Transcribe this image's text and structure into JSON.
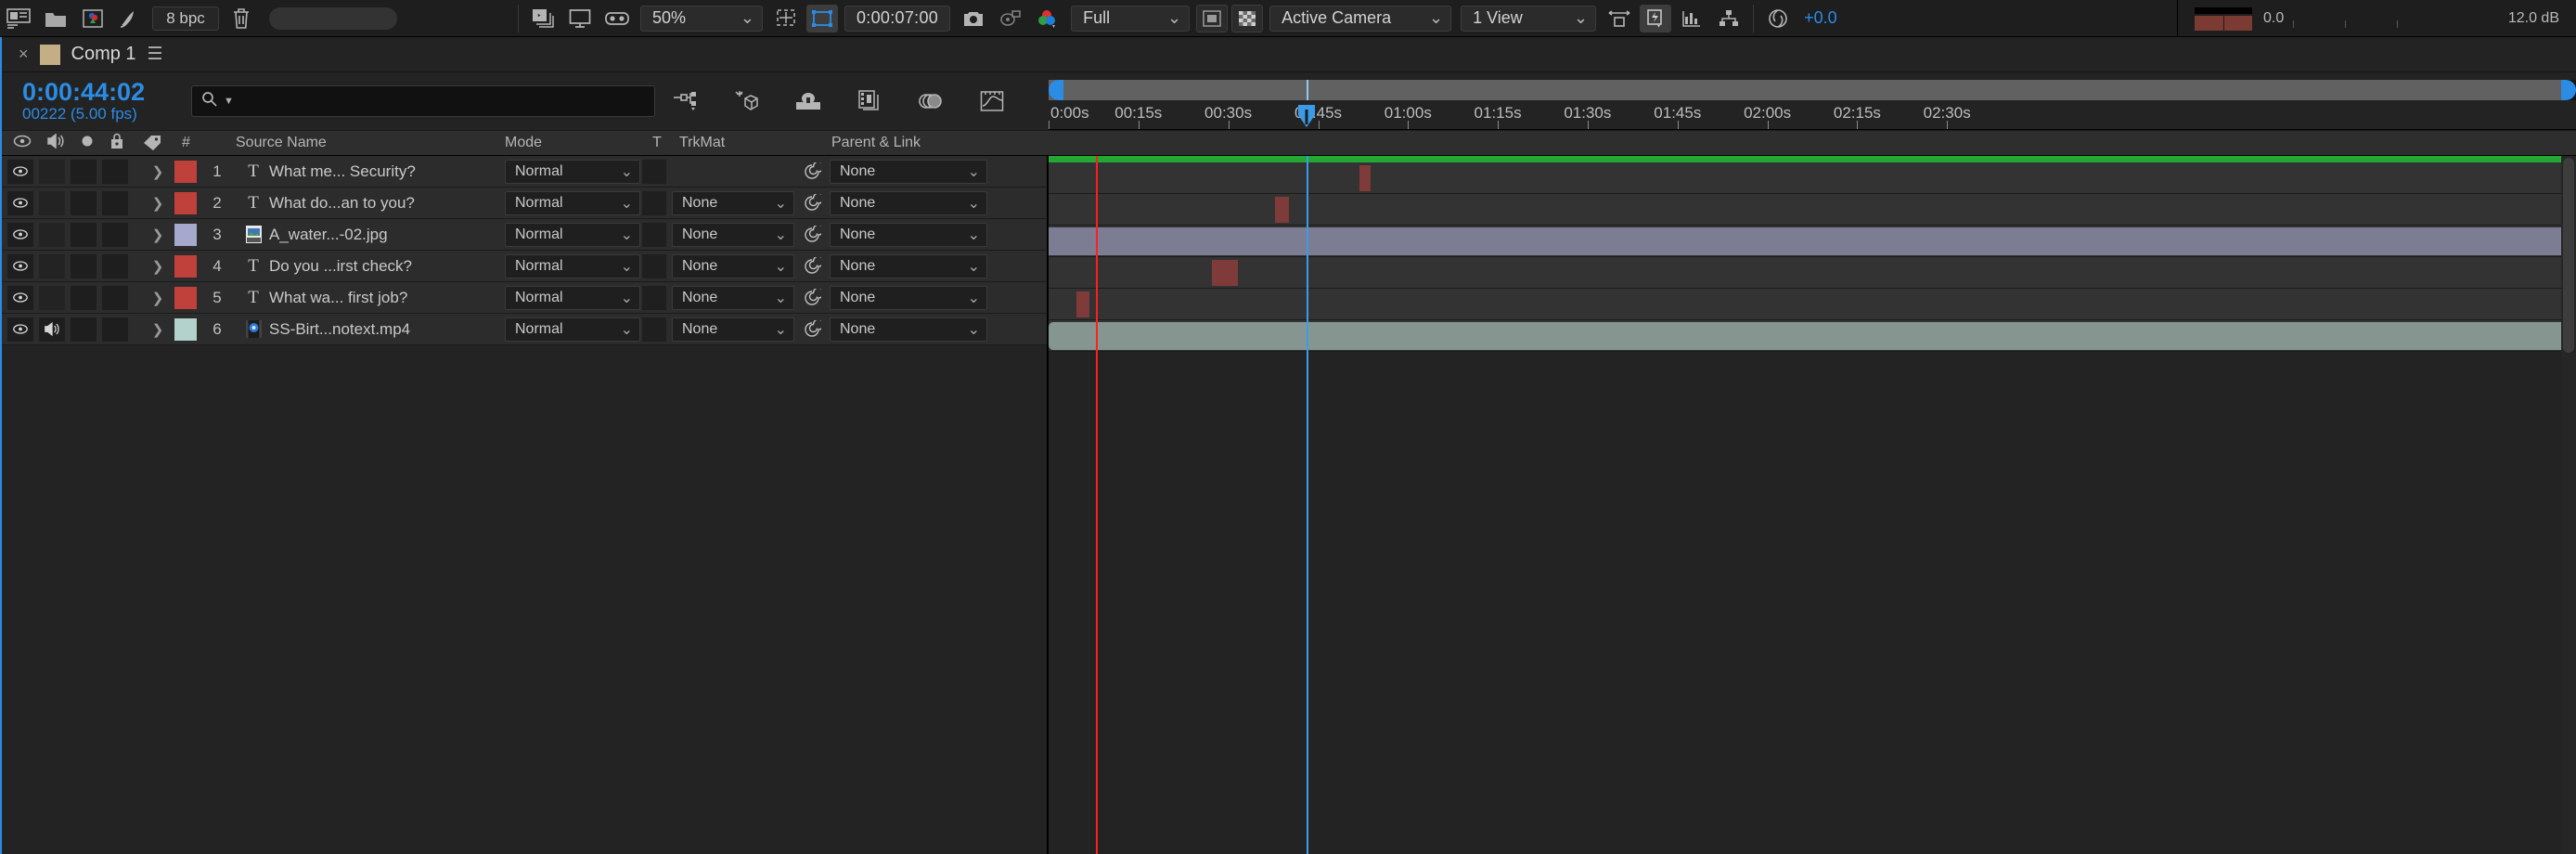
{
  "toolbar": {
    "left_icons": [
      "workspace-icon",
      "folder-icon",
      "project-media-icon",
      "rocket-icon"
    ],
    "bpc_label": "8 bpc",
    "trash_icon": "trash-icon",
    "search_pill": "search-pill",
    "render_icon": "render-queue-icon",
    "monitor_icon": "monitor-icon",
    "vr_icon": "vr-headset-icon",
    "zoom_value": "50%",
    "grid_icon": "grid-guides-icon",
    "region_icon": "region-of-interest-icon",
    "timecode": "0:00:07:00",
    "snapshot_icon": "camera-icon",
    "show_snapshot_icon": "show-snapshot-icon",
    "channels_icon": "channels-icon",
    "resolution": "Full",
    "mask_icon": "mask-icon",
    "transparency_icon": "transparency-grid-icon",
    "camera_view": "Active Camera",
    "view_layout": "1 View",
    "pixel_aspect_icon": "pixel-aspect-icon",
    "fast_preview_icon": "fast-preview-icon",
    "histogram_icon": "histogram-icon",
    "flowchart_icon": "flowchart-icon",
    "exposure_icon": "exposure-icon",
    "exposure_value": "+0.0",
    "audio_level_value": "0.0",
    "audio_db": "12.0 dB"
  },
  "tab": {
    "close_label": "×",
    "title": "Comp 1",
    "menu_icon": "panel-menu-icon"
  },
  "timeline_header": {
    "current_time": "0:00:44:02",
    "frame_info": "00222 (5.00 fps)",
    "search_placeholder": "",
    "search_value": "",
    "tools": [
      "composition-mini-flowchart-icon",
      "draft-3d-icon",
      "hide-shy-layers-icon",
      "frame-blending-icon",
      "motion-blur-icon",
      "graph-editor-icon"
    ]
  },
  "ruler": {
    "ticks": [
      {
        "label": "0:00s",
        "pos": 0.0
      },
      {
        "label": "00:15s",
        "pos": 0.0588
      },
      {
        "label": "00:30s",
        "pos": 0.1176
      },
      {
        "label": "00:45s",
        "pos": 0.1765
      },
      {
        "label": "01:00s",
        "pos": 0.2353
      },
      {
        "label": "01:15s",
        "pos": 0.2941
      },
      {
        "label": "01:30s",
        "pos": 0.3529
      },
      {
        "label": "01:45s",
        "pos": 0.4118
      },
      {
        "label": "02:00s",
        "pos": 0.4706
      },
      {
        "label": "02:15s",
        "pos": 0.5294
      },
      {
        "label": "02:30s",
        "pos": 0.5882
      }
    ]
  },
  "columns": {
    "num": "#",
    "source_name": "Source Name",
    "mode": "Mode",
    "t": "T",
    "trkmat": "TrkMat",
    "parent_link": "Parent & Link",
    "toggle_icons": [
      "eye-icon",
      "audio-icon",
      "solo-icon",
      "lock-icon",
      "label-tag-icon"
    ]
  },
  "layers": [
    {
      "num": "1",
      "type_icon": "text-layer-icon",
      "name": "What me... Security?",
      "color": "#c0403c",
      "mode": "Normal",
      "trkmat": null,
      "parent": "None",
      "video_on": true,
      "audio_on": false,
      "clip": null,
      "keyframes": [
        {
          "left": 0.2054,
          "width": 0.0075
        }
      ]
    },
    {
      "num": "2",
      "type_icon": "text-layer-icon",
      "name": "What do...an to you?",
      "color": "#c0403c",
      "mode": "Normal",
      "trkmat": "None",
      "parent": "None",
      "video_on": true,
      "audio_on": false,
      "clip": null,
      "keyframes": [
        {
          "left": 0.1494,
          "width": 0.0098
        }
      ]
    },
    {
      "num": "3",
      "type_icon": "jpeg-file-icon",
      "name": "A_water...-02.jpg",
      "color": "#a6a8cd",
      "mode": "Normal",
      "trkmat": "None",
      "parent": "None",
      "video_on": true,
      "audio_on": false,
      "clip": {
        "kind": "img",
        "left": 0.0,
        "width": 1.0
      },
      "keyframes": []
    },
    {
      "num": "4",
      "type_icon": "text-layer-icon",
      "name": "Do you ...irst check?",
      "color": "#c0403c",
      "mode": "Normal",
      "trkmat": "None",
      "parent": "None",
      "video_on": true,
      "audio_on": false,
      "clip": null,
      "keyframes": [
        {
          "left": 0.1077,
          "width": 0.0176
        }
      ]
    },
    {
      "num": "5",
      "type_icon": "text-layer-icon",
      "name": "What wa...  first job?",
      "color": "#c0403c",
      "mode": "Normal",
      "trkmat": "None",
      "parent": "None",
      "video_on": true,
      "audio_on": false,
      "clip": null,
      "keyframes": [
        {
          "left": 0.0185,
          "width": 0.0087
        }
      ]
    },
    {
      "num": "6",
      "type_icon": "mp4-file-icon",
      "name": "SS-Birt...notext.mp4",
      "color": "#b3d2cb",
      "mode": "Normal",
      "trkmat": "None",
      "parent": "None",
      "video_on": true,
      "audio_on": true,
      "clip": {
        "kind": "vid",
        "left": 0.0,
        "width": 1.0
      },
      "keyframes": []
    }
  ],
  "playheads": {
    "red_marker_pos": 0.0313,
    "cti_pos": 0.1704
  },
  "colors": {
    "accent_blue": "#2b8ce5",
    "work_area_green": "#22a833",
    "playhead_red": "#ff1f1f",
    "keyframe_red": "#7e3b39",
    "panel_bg": "#232323",
    "row_bg": "#2c2c2c",
    "track_bg": "#333333"
  }
}
